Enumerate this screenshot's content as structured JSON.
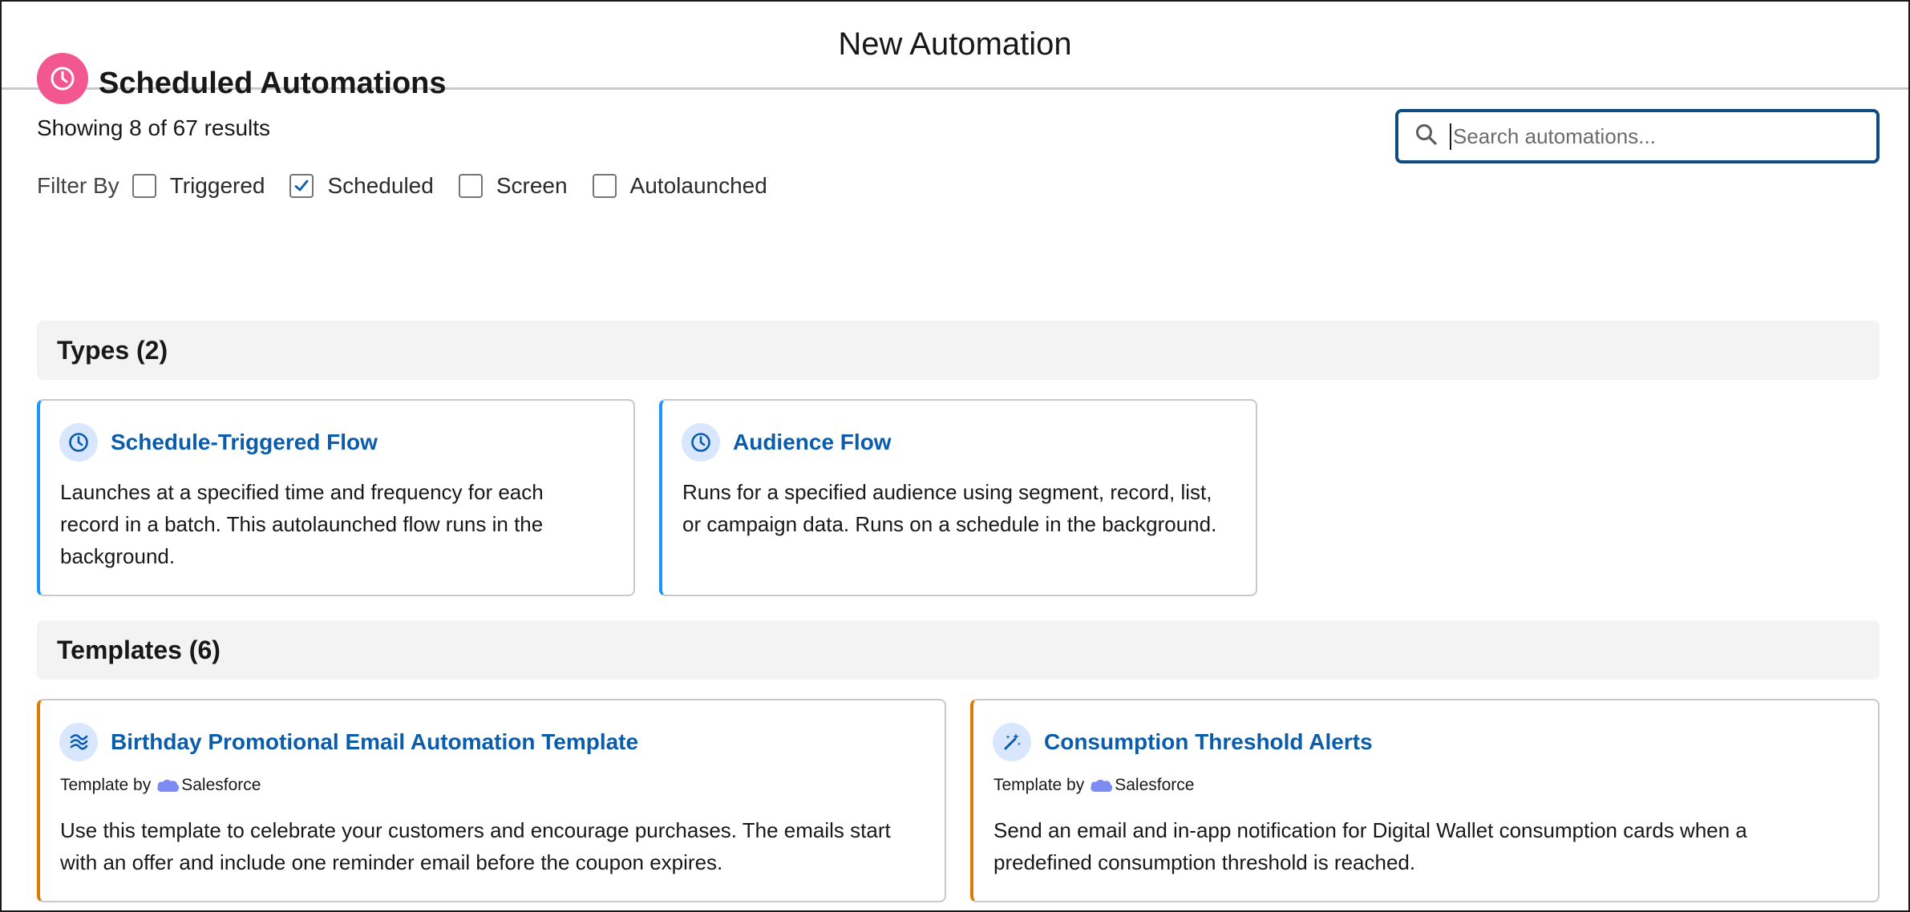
{
  "header": {
    "title": "New Automation"
  },
  "page": {
    "title": "Scheduled Automations",
    "results": "Showing 8 of 67 results"
  },
  "search": {
    "placeholder": "Search automations..."
  },
  "filters": {
    "label": "Filter By",
    "items": [
      {
        "label": "Triggered",
        "checked": false
      },
      {
        "label": "Scheduled",
        "checked": true
      },
      {
        "label": "Screen",
        "checked": false
      },
      {
        "label": "Autolaunched",
        "checked": false
      }
    ]
  },
  "sections": {
    "types": {
      "title": "Types (2)",
      "cards": [
        {
          "title": "Schedule-Triggered Flow",
          "icon": "clock-icon",
          "description": "Launches at a specified time and frequency for each record in a batch. This autolaunched flow runs in the background."
        },
        {
          "title": "Audience Flow",
          "icon": "clock-icon",
          "description": "Runs for a specified audience using segment, record, list, or campaign data. Runs on a schedule in the background."
        }
      ]
    },
    "templates": {
      "title": "Templates (6)",
      "cards": [
        {
          "title": "Birthday Promotional Email Automation Template",
          "icon": "flow-icon",
          "byline_prefix": "Template by",
          "byline_vendor": "Salesforce",
          "description": "Use this template to celebrate your customers and encourage purchases. The emails start with an offer and include one reminder email before the coupon expires."
        },
        {
          "title": "Consumption Threshold Alerts",
          "icon": "magic-wand-icon",
          "byline_prefix": "Template by",
          "byline_vendor": "Salesforce",
          "description": "Send an email and in-app notification for Digital Wallet consumption cards when a predefined consumption threshold is reached."
        }
      ]
    }
  },
  "colors": {
    "title_icon_bg": "#f2578f",
    "link_blue": "#0b5cab",
    "type_accent": "#1b96ff",
    "template_accent": "#dd7a01",
    "search_border": "#0f4c81",
    "section_bg": "#f3f3f3"
  }
}
